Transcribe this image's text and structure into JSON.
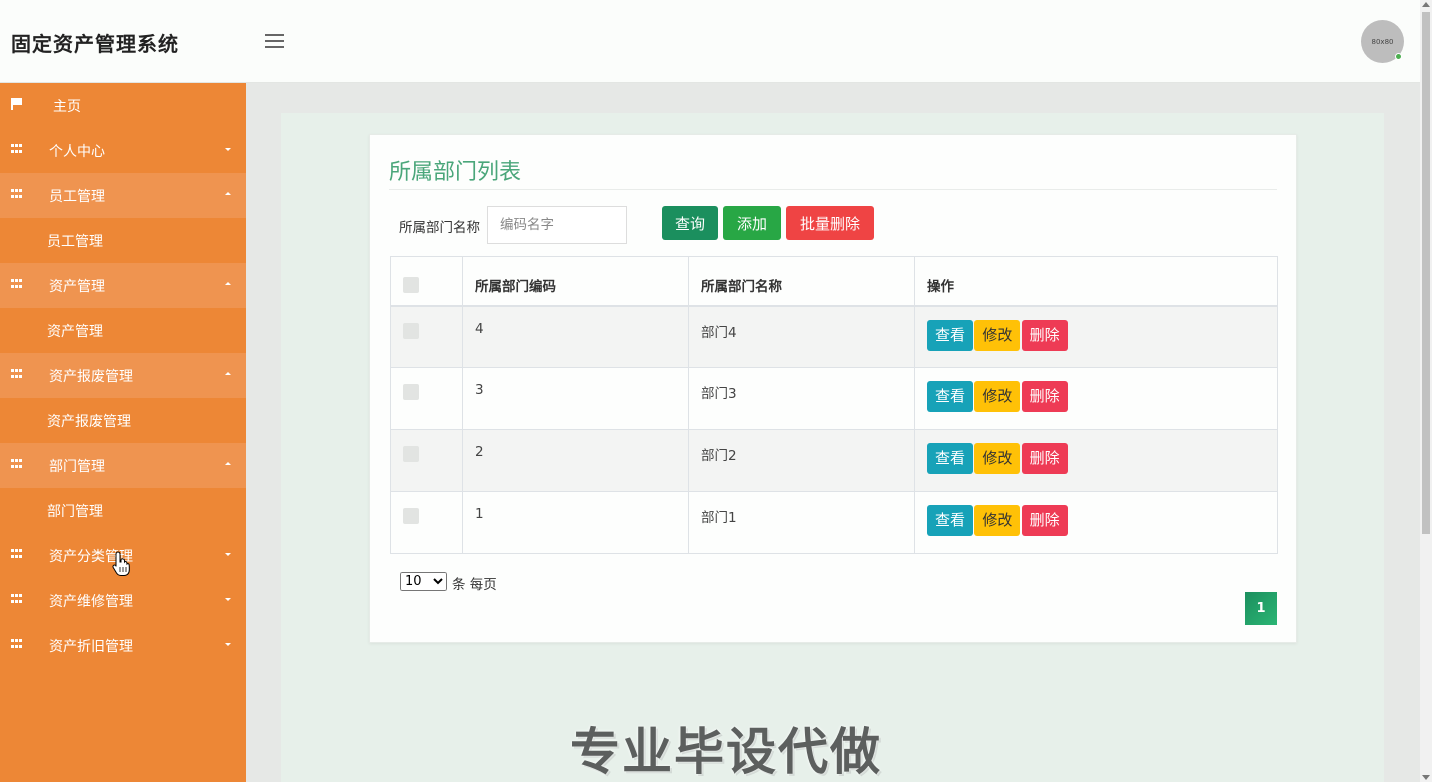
{
  "header": {
    "app_title": "固定资产管理系统",
    "avatar_text": "80x80"
  },
  "sidebar": {
    "items": [
      {
        "label": "主页",
        "icon": "flag-icon"
      },
      {
        "label": "个人中心",
        "icon": "grid-icon",
        "expanded": false
      },
      {
        "label": "员工管理",
        "icon": "grid-icon",
        "expanded": true,
        "sub": "员工管理"
      },
      {
        "label": "资产管理",
        "icon": "grid-icon",
        "expanded": true,
        "sub": "资产管理"
      },
      {
        "label": "资产报废管理",
        "icon": "grid-icon",
        "expanded": true,
        "sub": "资产报废管理"
      },
      {
        "label": "部门管理",
        "icon": "grid-icon",
        "expanded": true,
        "sub": "部门管理"
      },
      {
        "label": "资产分类管理",
        "icon": "grid-icon",
        "expanded": false
      },
      {
        "label": "资产维修管理",
        "icon": "grid-icon",
        "expanded": false
      },
      {
        "label": "资产折旧管理",
        "icon": "grid-icon",
        "expanded": false
      }
    ]
  },
  "main": {
    "title": "所属部门列表",
    "search": {
      "label": "所属部门名称",
      "placeholder": "编码名字",
      "value": ""
    },
    "buttons": {
      "query": "查询",
      "add": "添加",
      "batch_delete": "批量删除"
    },
    "table": {
      "headers": [
        "所属部门编码",
        "所属部门名称",
        "操作"
      ],
      "rows": [
        {
          "code": "4",
          "name": "部门4"
        },
        {
          "code": "3",
          "name": "部门3"
        },
        {
          "code": "2",
          "name": "部门2"
        },
        {
          "code": "1",
          "name": "部门1"
        }
      ],
      "actions": {
        "view": "查看",
        "edit": "修改",
        "delete": "删除"
      }
    },
    "pagination": {
      "page_size": "10",
      "page_size_options": [
        "10"
      ],
      "per_page_text": "条 每页",
      "current_page": "1"
    }
  },
  "watermark": "专业毕设代做",
  "colors": {
    "sidebar": "#ed8736",
    "accent_green": "#1b8f5e",
    "title_green": "#4aa67a",
    "danger": "#ef4444",
    "info": "#17a2b8",
    "warning": "#ffc107"
  }
}
